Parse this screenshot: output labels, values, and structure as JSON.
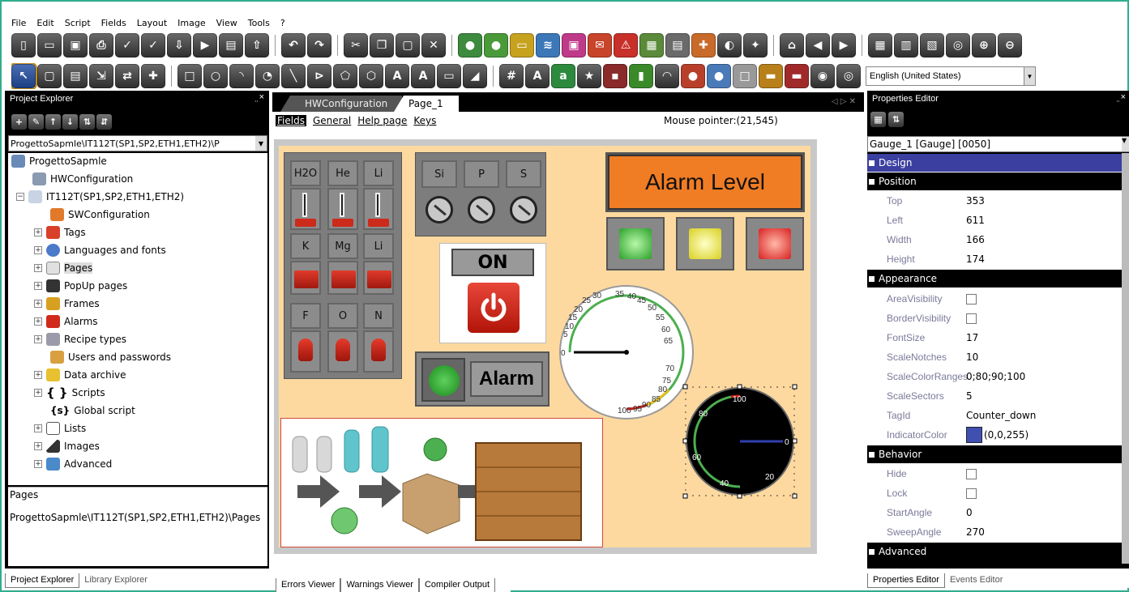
{
  "menu": [
    "File",
    "Edit",
    "Script",
    "Fields",
    "Layout",
    "Image",
    "View",
    "Tools",
    "?"
  ],
  "toolbar": {
    "language": "English (United States)"
  },
  "project_explorer": {
    "title": "Project Explorer",
    "pin": "̤ ×",
    "path_combo": "ProgettoSapmle\\IT112T(SP1,SP2,ETH1,ETH2)\\P",
    "tree": [
      "ProgettoSapmle",
      "HWConfiguration",
      "IT112T(SP1,SP2,ETH1,ETH2)",
      "SWConfiguration",
      "Tags",
      "Languages and fonts",
      "Pages",
      "PopUp pages",
      "Frames",
      "Alarms",
      "Recipe types",
      "Users and passwords",
      "Data archive",
      "Scripts",
      "Global script",
      "Lists",
      "Images",
      "Advanced"
    ],
    "desc_title": "Pages",
    "desc_path": "ProgettoSapmle\\IT112T(SP1,SP2,ETH1,ETH2)\\Pages",
    "tabs": [
      "Project Explorer",
      "Library Explorer"
    ]
  },
  "editor": {
    "tabs": [
      "HWConfiguration",
      "Page_1"
    ],
    "subtabs": [
      "Fields",
      "General",
      "Help page",
      "Keys"
    ],
    "mouse_pointer": "Mouse pointer:(21,545)",
    "output_tabs": [
      "Errors Viewer",
      "Warnings Viewer",
      "Compiler Output"
    ]
  },
  "hmi": {
    "row1": [
      "H2O",
      "He",
      "Li"
    ],
    "row2": [
      "K",
      "Mg",
      "Li"
    ],
    "row3": [
      "F",
      "O",
      "N"
    ],
    "knobs": [
      "Si",
      "P",
      "S"
    ],
    "alarm_level": "Alarm Level",
    "on_label": "ON",
    "alarm_label": "Alarm",
    "gauge1_labels": [
      "0",
      "5",
      "10",
      "15",
      "20",
      "25",
      "30",
      "35",
      "40",
      "45",
      "50",
      "55",
      "60",
      "65",
      "70",
      "75",
      "80",
      "85",
      "90",
      "95",
      "100"
    ],
    "gauge2_labels": [
      "0",
      "20",
      "40",
      "60",
      "80",
      "100"
    ]
  },
  "properties": {
    "title": "Properties Editor",
    "pin": "̤ ×",
    "object": "Gauge_1 [Gauge] [0050]",
    "categories": {
      "design": "Design",
      "position": "Position",
      "appearance": "Appearance",
      "behavior": "Behavior",
      "advanced": "Advanced"
    },
    "position": [
      {
        "k": "Top",
        "v": "353"
      },
      {
        "k": "Left",
        "v": "611"
      },
      {
        "k": "Width",
        "v": "166"
      },
      {
        "k": "Height",
        "v": "174"
      }
    ],
    "appearance": [
      {
        "k": "AreaVisibility",
        "v": ""
      },
      {
        "k": "BorderVisibility",
        "v": ""
      },
      {
        "k": "FontSize",
        "v": "17"
      },
      {
        "k": "ScaleNotches",
        "v": "10"
      },
      {
        "k": "ScaleColorRanges",
        "v": "0;80;90;100"
      },
      {
        "k": "ScaleSectors",
        "v": "5"
      },
      {
        "k": "TagId",
        "v": "Counter_down"
      },
      {
        "k": "IndicatorColor",
        "v": "(0,0,255)"
      }
    ],
    "behavior": [
      {
        "k": "Hide",
        "v": ""
      },
      {
        "k": "Lock",
        "v": ""
      },
      {
        "k": "StartAngle",
        "v": "0"
      },
      {
        "k": "SweepAngle",
        "v": "270"
      }
    ],
    "tabs": [
      "Properties Editor",
      "Events Editor"
    ]
  }
}
